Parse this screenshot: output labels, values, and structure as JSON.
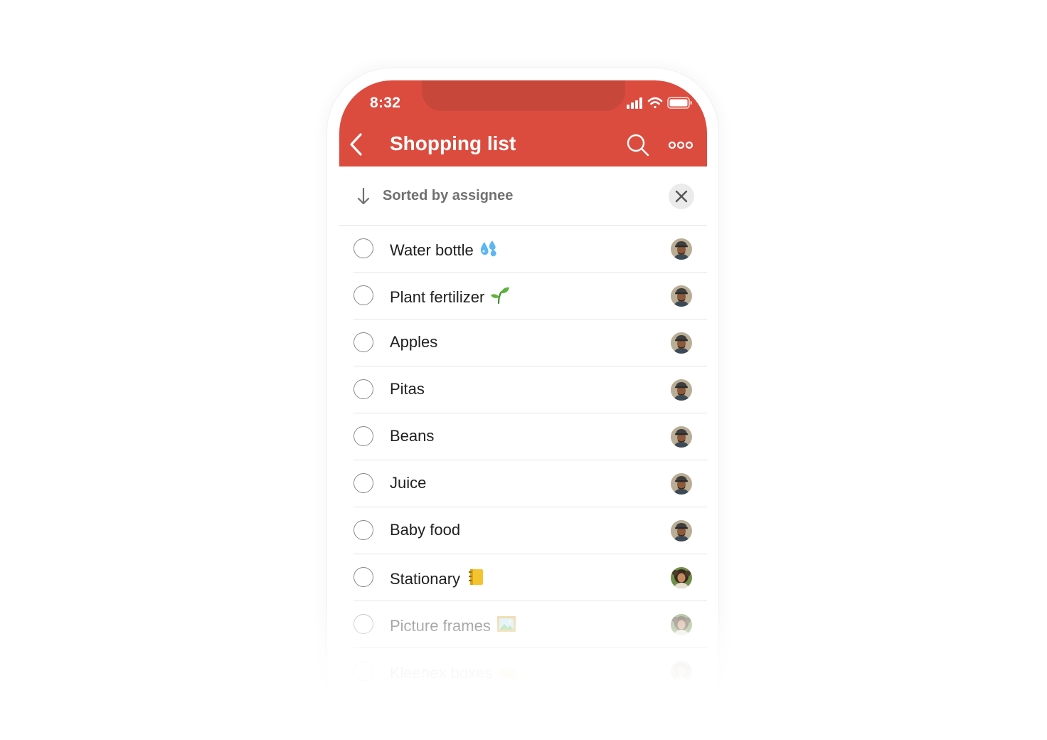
{
  "status_bar": {
    "time": "8:32",
    "icons": [
      "signal-icon",
      "wifi-icon",
      "battery-icon"
    ]
  },
  "header": {
    "title": "Shopping list",
    "back_icon": "chevron-left-icon",
    "search_icon": "search-icon",
    "more_icon": "more-horizontal-icon"
  },
  "sort": {
    "label": "Sorted by assignee",
    "icon": "arrow-down-icon",
    "clear_icon": "close-icon"
  },
  "tasks": [
    {
      "label": "Water bottle",
      "emoji": "sweat-droplets",
      "assignee": "man-with-cap"
    },
    {
      "label": "Plant fertilizer",
      "emoji": "seedling",
      "assignee": "man-with-cap"
    },
    {
      "label": "Apples",
      "emoji": "",
      "assignee": "man-with-cap"
    },
    {
      "label": "Pitas",
      "emoji": "",
      "assignee": "man-with-cap"
    },
    {
      "label": "Beans",
      "emoji": "",
      "assignee": "man-with-cap"
    },
    {
      "label": "Juice",
      "emoji": "",
      "assignee": "man-with-cap"
    },
    {
      "label": "Baby food",
      "emoji": "",
      "assignee": "man-with-cap"
    },
    {
      "label": "Stationary",
      "emoji": "notebook",
      "assignee": "woman-curly-hair"
    },
    {
      "label": "Picture frames",
      "emoji": "framed-picture",
      "assignee": "woman-curly-hair"
    },
    {
      "label": "Kleenex boxes",
      "emoji": "tissue-box",
      "assignee": "woman-curly-hair"
    }
  ],
  "colors": {
    "brand": "#db4c3f",
    "notch": "#c8473b",
    "text": "#202020",
    "muted": "#707070"
  }
}
